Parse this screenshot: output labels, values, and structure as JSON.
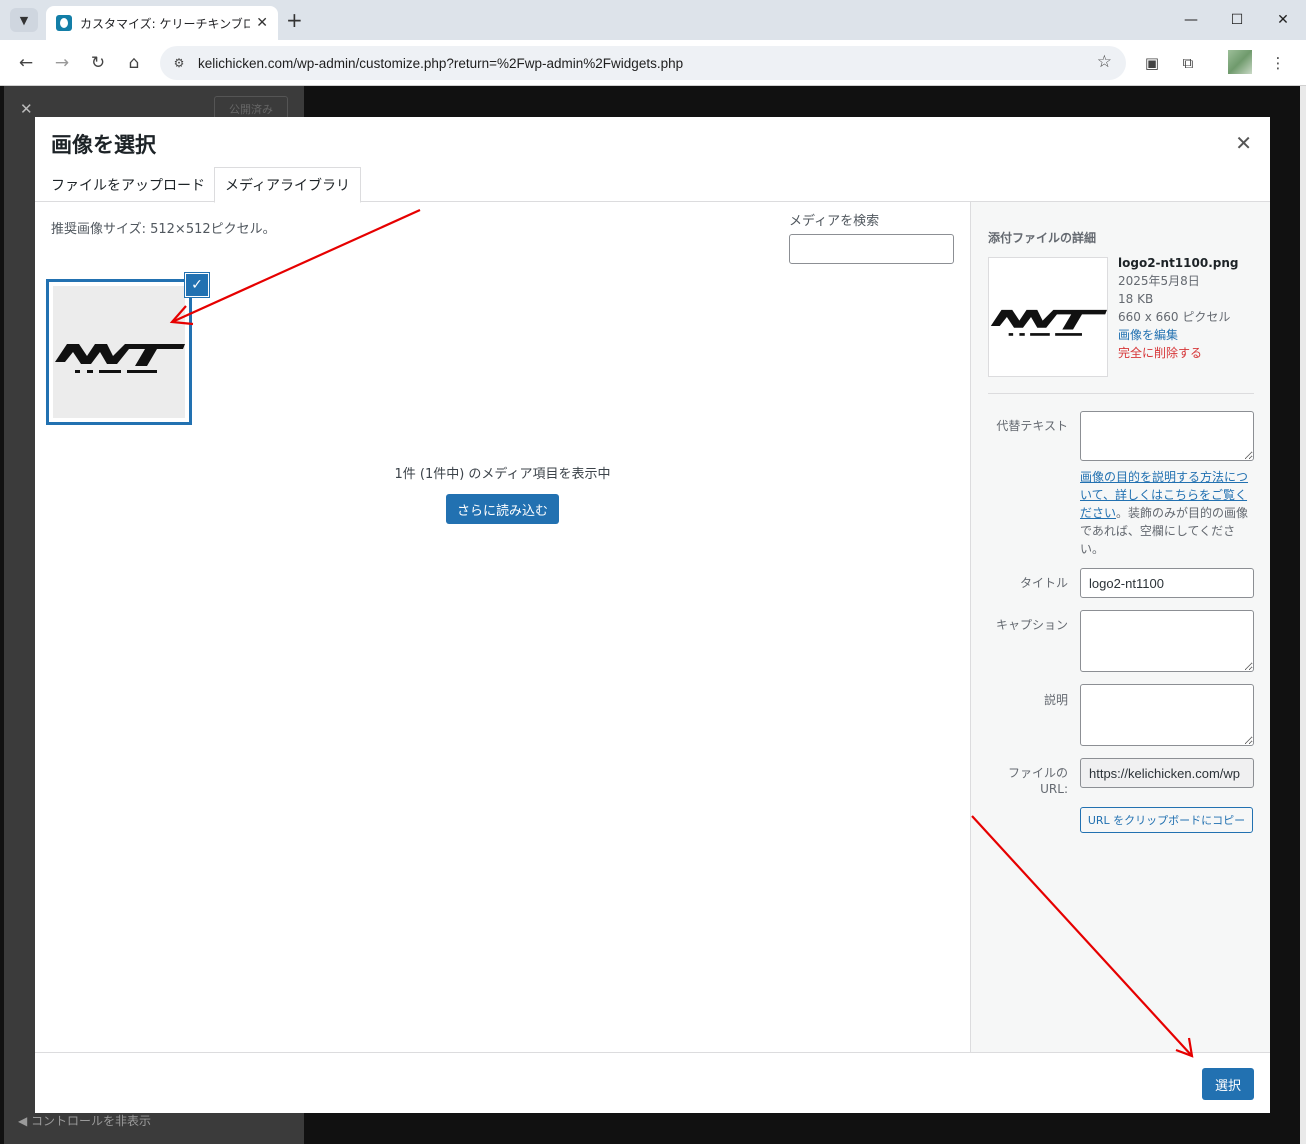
{
  "browser": {
    "tab_title": "カスタマイズ: ケリーチキンブログ | ケリ",
    "url": "kelichicken.com/wp-admin/customize.php?return=%2Fwp-admin%2Fwidgets.php"
  },
  "customizer": {
    "published_label": "公開済み",
    "hide_controls_label": "コントロールを非表示"
  },
  "modal": {
    "title": "画像を選択",
    "tabs": [
      {
        "label": "ファイルをアップロード",
        "active": false
      },
      {
        "label": "メディアライブラリ",
        "active": true
      }
    ],
    "suggested_size": "推奨画像サイズ: 512×512ピクセル。",
    "search_label": "メディアを検索",
    "search_value": "",
    "count_text": "1件 (1件中) のメディア項目を表示中",
    "load_more_label": "さらに読み込む",
    "select_label": "選択"
  },
  "attachment": {
    "heading": "添付ファイルの詳細",
    "filename": "logo2-nt1100.png",
    "date": "2025年5月8日",
    "filesize": "18 KB",
    "dimensions": "660 x 660 ピクセル",
    "edit_label": "画像を編集",
    "delete_label": "完全に削除する",
    "alt_label": "代替テキスト",
    "alt_value": "",
    "alt_help_link": "画像の目的を説明する方法について、詳しくはこちらをご覧ください",
    "alt_help_text": "。装飾のみが目的の画像であれば、空欄にしてください。",
    "title_label": "タイトル",
    "title_value": "logo2-nt1100",
    "caption_label": "キャプション",
    "caption_value": "",
    "description_label": "説明",
    "description_value": "",
    "url_label": "ファイルの URL:",
    "url_value": "https://kelichicken.com/wp",
    "copy_label": "URL をクリップボードにコピー"
  },
  "colors": {
    "primary": "#2271b1",
    "danger": "#d63638",
    "annotation_arrow": "#e60000"
  }
}
